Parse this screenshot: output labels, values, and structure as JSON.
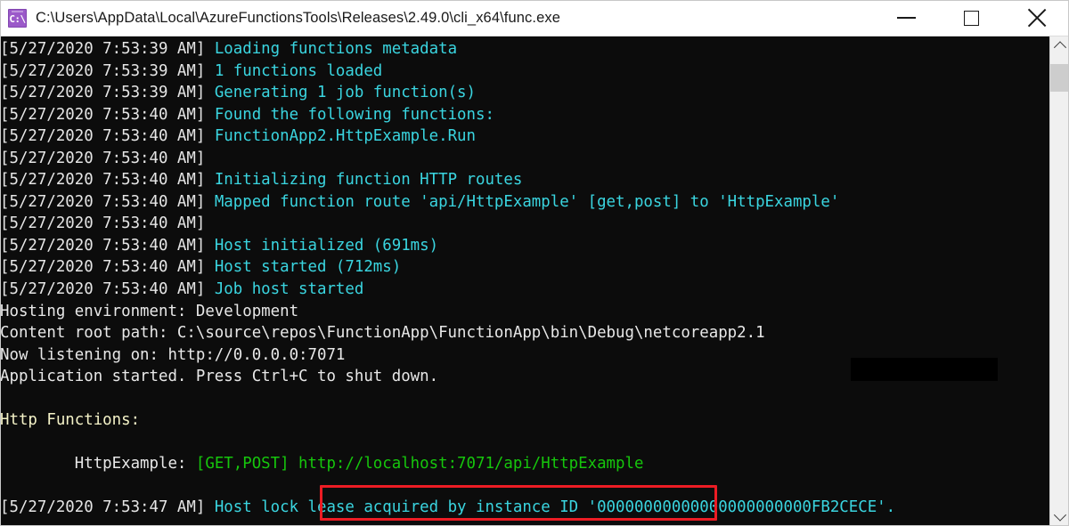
{
  "window": {
    "title": "C:\\Users\\AppData\\Local\\AzureFunctionsTools\\Releases\\2.49.0\\cli_x64\\func.exe",
    "icon_glyph": "C:\\",
    "icon_name": "console-app-icon",
    "controls": {
      "minimize_label": "Minimize",
      "maximize_label": "Maximize",
      "close_label": "Close"
    }
  },
  "colors": {
    "background": "#0c0c0c",
    "timestamp": "#e6e6e6",
    "info_cyan": "#3ad5e0",
    "plain_white": "#e8e8e8",
    "heading_yellow": "#f5f3c8",
    "url_green": "#16c60c",
    "annotation_red": "#ec1c24",
    "titlebar": "#ffffff"
  },
  "console": {
    "lines": [
      {
        "parts": [
          {
            "text": "[5/27/2020 7:53:39 AM] ",
            "color": "ts"
          },
          {
            "text": "Loading functions metadata",
            "color": "cyan"
          }
        ]
      },
      {
        "parts": [
          {
            "text": "[5/27/2020 7:53:39 AM] ",
            "color": "ts"
          },
          {
            "text": "1 functions loaded",
            "color": "cyan"
          }
        ]
      },
      {
        "parts": [
          {
            "text": "[5/27/2020 7:53:39 AM] ",
            "color": "ts"
          },
          {
            "text": "Generating 1 job function(s)",
            "color": "cyan"
          }
        ]
      },
      {
        "parts": [
          {
            "text": "[5/27/2020 7:53:40 AM] ",
            "color": "ts"
          },
          {
            "text": "Found the following functions:",
            "color": "cyan"
          }
        ]
      },
      {
        "parts": [
          {
            "text": "[5/27/2020 7:53:40 AM] ",
            "color": "ts"
          },
          {
            "text": "FunctionApp2.HttpExample.Run",
            "color": "cyan"
          }
        ]
      },
      {
        "parts": [
          {
            "text": "[5/27/2020 7:53:40 AM] ",
            "color": "ts"
          }
        ]
      },
      {
        "parts": [
          {
            "text": "[5/27/2020 7:53:40 AM] ",
            "color": "ts"
          },
          {
            "text": "Initializing function HTTP routes",
            "color": "cyan"
          }
        ]
      },
      {
        "parts": [
          {
            "text": "[5/27/2020 7:53:40 AM] ",
            "color": "ts"
          },
          {
            "text": "Mapped function route 'api/HttpExample' [get,post] to 'HttpExample'",
            "color": "cyan"
          }
        ]
      },
      {
        "parts": [
          {
            "text": "[5/27/2020 7:53:40 AM] ",
            "color": "ts"
          }
        ]
      },
      {
        "parts": [
          {
            "text": "[5/27/2020 7:53:40 AM] ",
            "color": "ts"
          },
          {
            "text": "Host initialized (691ms)",
            "color": "cyan"
          }
        ]
      },
      {
        "parts": [
          {
            "text": "[5/27/2020 7:53:40 AM] ",
            "color": "ts"
          },
          {
            "text": "Host started (712ms)",
            "color": "cyan"
          }
        ]
      },
      {
        "parts": [
          {
            "text": "[5/27/2020 7:53:40 AM] ",
            "color": "ts"
          },
          {
            "text": "Job host started",
            "color": "cyan"
          }
        ]
      },
      {
        "parts": [
          {
            "text": "Hosting environment: Development",
            "color": "white"
          }
        ]
      },
      {
        "parts": [
          {
            "text": "Content root path: C:\\source\\repos\\FunctionApp\\FunctionApp\\bin\\Debug\\netcoreapp2.1",
            "color": "white"
          }
        ]
      },
      {
        "parts": [
          {
            "text": "Now listening on: http://0.0.0.0:7071",
            "color": "white"
          }
        ]
      },
      {
        "parts": [
          {
            "text": "Application started. Press Ctrl+C to shut down.",
            "color": "white"
          }
        ]
      },
      {
        "parts": [
          {
            "text": "",
            "color": "white"
          }
        ]
      },
      {
        "parts": [
          {
            "text": "Http Functions:",
            "color": "yellow"
          }
        ]
      },
      {
        "parts": [
          {
            "text": "",
            "color": "white"
          }
        ]
      },
      {
        "parts": [
          {
            "text": "        HttpExample: ",
            "color": "white"
          },
          {
            "text": "[GET,POST] ",
            "color": "green"
          },
          {
            "text": "http://localhost:7071/api/HttpExample",
            "color": "green"
          }
        ]
      },
      {
        "parts": [
          {
            "text": "",
            "color": "white"
          }
        ]
      },
      {
        "parts": [
          {
            "text": "[5/27/2020 7:53:47 AM] ",
            "color": "ts"
          },
          {
            "text": "Host lock lease acquired by instance ID '00000000000000000000000FB2CECE'.",
            "color": "cyan"
          }
        ]
      }
    ],
    "highlighted_url": "http://localhost:7071/api/HttpExample",
    "http_methods": "[GET,POST]",
    "function_name": "HttpExample:",
    "section_heading": "Http Functions:",
    "redacted_text": ""
  },
  "scrollbar": {
    "up_arrow_name": "scroll-up-arrow",
    "down_arrow_name": "scroll-down-arrow",
    "thumb_name": "scroll-thumb"
  }
}
